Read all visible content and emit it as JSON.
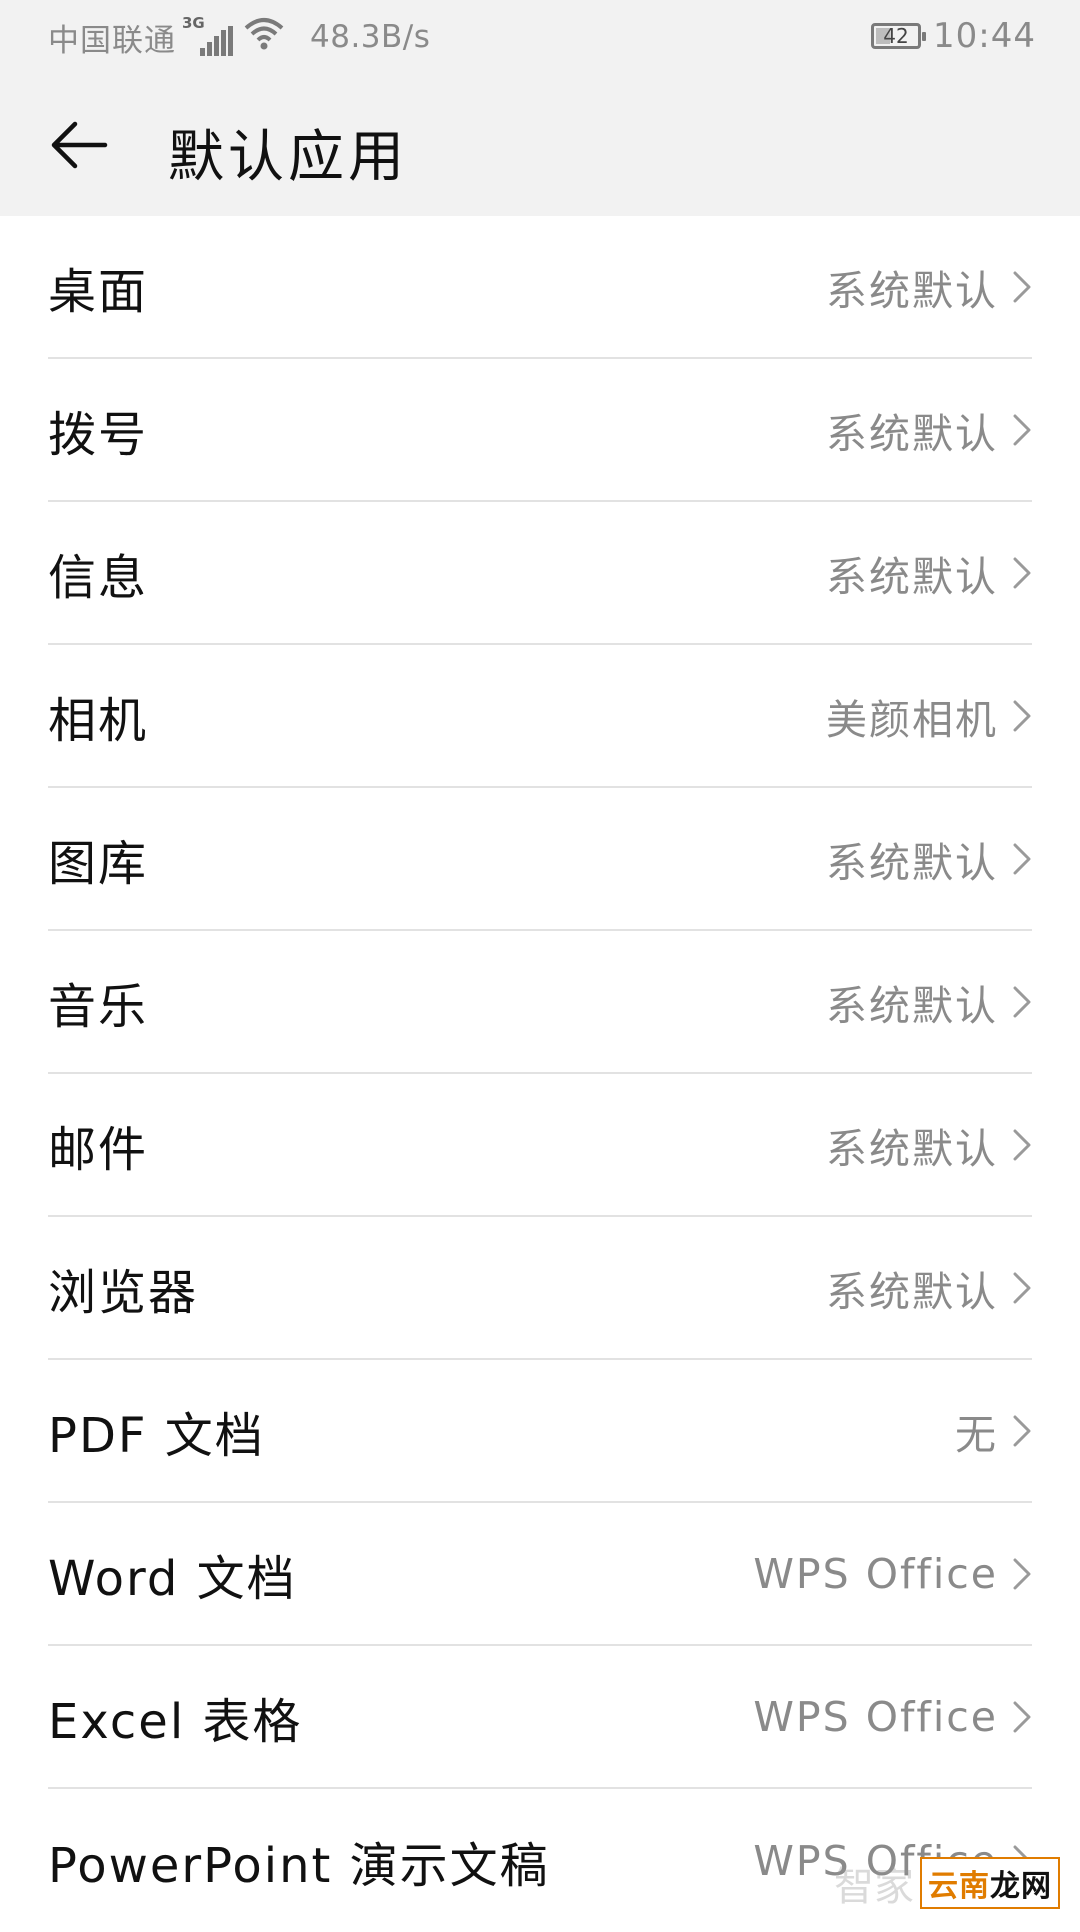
{
  "status_bar": {
    "carrier": "中国联通",
    "network_type": "3G",
    "speed": "48.3B/s",
    "battery": "42",
    "battery_level_percent": 42,
    "time": "10:44",
    "icons": [
      "signal-icon",
      "wifi-icon",
      "battery-icon"
    ]
  },
  "app_bar": {
    "back_icon": "arrow-left-icon",
    "title": "默认应用"
  },
  "colors": {
    "header_bg": "#f2f2f2",
    "secondary_text": "#8a8a8a",
    "divider": "#e2e2e2"
  },
  "items": [
    {
      "label": "桌面",
      "value": "系统默认"
    },
    {
      "label": "拨号",
      "value": "系统默认"
    },
    {
      "label": "信息",
      "value": "系统默认"
    },
    {
      "label": "相机",
      "value": "美颜相机"
    },
    {
      "label": "图库",
      "value": "系统默认"
    },
    {
      "label": "音乐",
      "value": "系统默认"
    },
    {
      "label": "邮件",
      "value": "系统默认"
    },
    {
      "label": "浏览器",
      "value": "系统默认"
    },
    {
      "label": "PDF 文档",
      "value": "无"
    },
    {
      "label": "Word 文档",
      "value": "WPS Office"
    },
    {
      "label": "Excel 表格",
      "value": "WPS Office"
    },
    {
      "label": "PowerPoint 演示文稿",
      "value": "WPS Office"
    }
  ],
  "watermark": {
    "faint": "智家",
    "main_prefix": "云南",
    "main_suffix": "龙网"
  }
}
